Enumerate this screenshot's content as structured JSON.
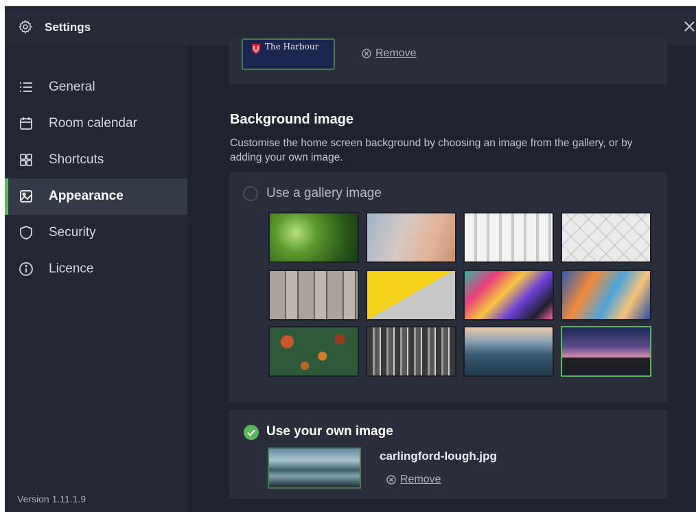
{
  "window": {
    "title": "Settings"
  },
  "sidebar": {
    "items": [
      {
        "label": "General",
        "icon": "list-icon"
      },
      {
        "label": "Room calendar",
        "icon": "calendar-icon"
      },
      {
        "label": "Shortcuts",
        "icon": "grid-icon"
      },
      {
        "label": "Appearance",
        "icon": "image-icon",
        "active": true
      },
      {
        "label": "Security",
        "icon": "shield-icon"
      },
      {
        "label": "Licence",
        "icon": "info-icon"
      }
    ],
    "version": "Version 1.11.1.9"
  },
  "logo": {
    "thumb_text": "The Harbour",
    "remove_label": "Remove"
  },
  "background": {
    "title": "Background image",
    "description": "Customise the home screen background by choosing an image from the gallery, or by adding your own image.",
    "gallery_option_label": "Use a gallery image",
    "gallery_selected": false,
    "gallery": [
      "green-bokeh",
      "peach-blur",
      "white-blocks",
      "white-tiles",
      "wood-planks",
      "yellow-concrete",
      "colorful-paint",
      "blue-orange-paint",
      "autumn-foliage",
      "city-aerial",
      "ocean-waves",
      "mountain-stars"
    ],
    "highlighted_gallery_image": "mountain-stars",
    "own_option_label": "Use your own image",
    "own_selected": true,
    "own_filename": "carlingford-lough.jpg",
    "own_remove_label": "Remove"
  },
  "colors": {
    "accent": "#5cb85c",
    "background": "#1f2330",
    "card": "#2a2e3b"
  }
}
